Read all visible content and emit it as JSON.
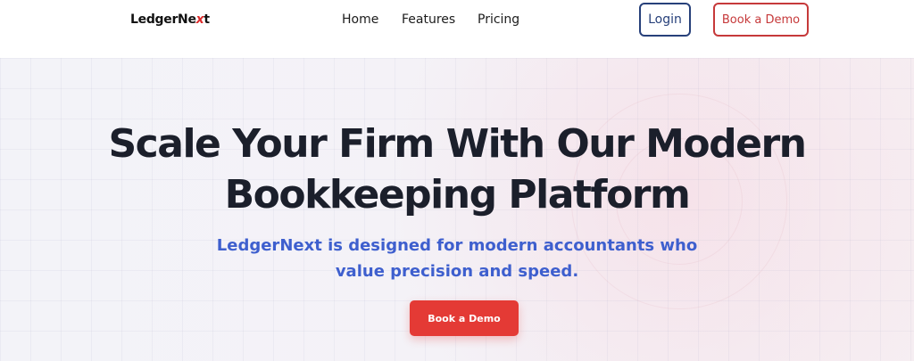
{
  "header": {
    "logo": {
      "text_main": "LedgerNe",
      "text_accent": "x",
      "text_end": "t"
    },
    "nav": [
      "Home",
      "Features",
      "Pricing"
    ],
    "login_label": "Login",
    "demo_label": "Book a Demo"
  },
  "hero": {
    "title_line1": "Scale Your Firm With Our Modern",
    "title_line2": "Bookkeeping Platform",
    "subtitle_line1": "LedgerNext is designed for modern accountants who",
    "subtitle_line2": "value precision and speed.",
    "cta_label": "Book a Demo"
  },
  "colors": {
    "brand_red": "#e43a35",
    "brand_navy": "#27407a",
    "subtitle_blue": "#3e5fce",
    "heading_dark": "#1b1f2b"
  }
}
